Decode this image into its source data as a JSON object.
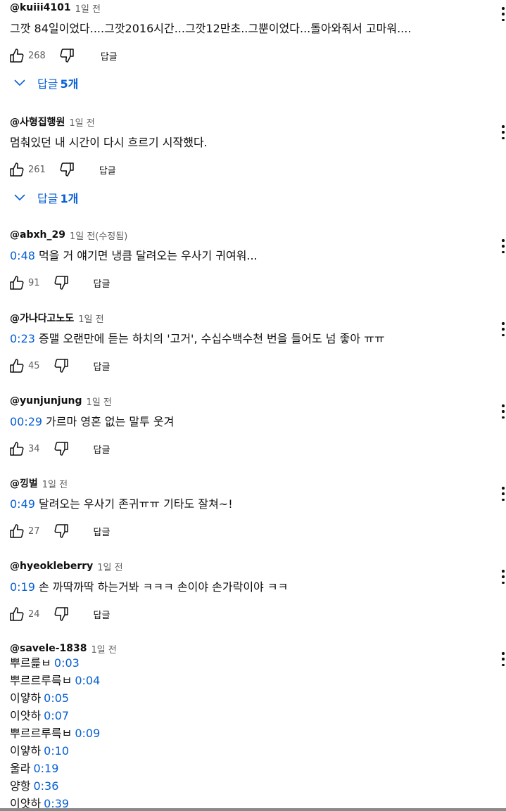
{
  "comments": [
    {
      "author": "@kuiii4101",
      "time": "1일 전",
      "timestamp": "",
      "text": "그깟 84일이었다....그깟2016시간...그깟12만초..그뿐이었다...돌아와줘서 고마워....",
      "likes": "268",
      "reply_label": "답글"
    },
    {
      "author": "@사형집행원",
      "time": "1일 전",
      "timestamp": "",
      "text": "멈춰있던 내 시간이 다시 흐르기 시작했다.",
      "likes": "261",
      "reply_label": "답글"
    },
    {
      "author": "@abxh_29",
      "time": "1일 전(수정됨)",
      "timestamp": "0:48",
      "text": "먹을 거 얘기면 냉큼 달려오는 우사기 귀여워...",
      "likes": "91",
      "reply_label": "답글"
    },
    {
      "author": "@가나다고노도",
      "time": "1일 전",
      "timestamp": "0:23",
      "text": "증맬 오랜만에 듣는 하치의 '고거', 수십수백수천 번을 들어도 넘 좋아 ㅠㅠ",
      "likes": "45",
      "reply_label": "답글"
    },
    {
      "author": "@yunjunjung",
      "time": "1일 전",
      "timestamp": "00:29",
      "text": "가르마 영혼 없는 말투 웃겨",
      "likes": "34",
      "reply_label": "답글"
    },
    {
      "author": "@낑벌",
      "time": "1일 전",
      "timestamp": "0:49",
      "text": "달려오는 우사기 존귀ㅠㅠ 기타도 잘쳐~!",
      "likes": "27",
      "reply_label": "답글"
    },
    {
      "author": "@hyeokleberry",
      "time": "1일 전",
      "timestamp": "0:19",
      "text": "손 까딱까딱 하는거봐 ㅋㅋㅋ 손이야 손가락이야 ㅋㅋ",
      "likes": "24",
      "reply_label": "답글"
    },
    {
      "author": "@savele-1838",
      "time": "1일 전"
    }
  ],
  "replies": [
    {
      "label": "답글",
      "count": "5개"
    },
    {
      "label": "답글",
      "count": "1개"
    }
  ],
  "last_comment_lines": [
    {
      "text": "뿌르릁ㅂ",
      "ts": "0:03"
    },
    {
      "text": "뿌르르루륵ㅂ",
      "ts": "0:04"
    },
    {
      "text": "이얗하",
      "ts": "0:05"
    },
    {
      "text": "이얏하",
      "ts": "0:07"
    },
    {
      "text": "뿌르르루륵ㅂ",
      "ts": "0:09"
    },
    {
      "text": "이얗하",
      "ts": "0:10"
    },
    {
      "text": "울라",
      "ts": "0:19"
    },
    {
      "text": "양항",
      "ts": "0:36"
    },
    {
      "text": "이얏하",
      "ts": "0:39"
    }
  ],
  "icons": {
    "like": "thumbs-up-icon",
    "dislike": "thumbs-down-icon",
    "more": "more-vert-icon",
    "chevron": "chevron-down-icon"
  },
  "colors": {
    "link": "#065fd4",
    "text": "#0f0f0f",
    "muted": "#606060"
  }
}
